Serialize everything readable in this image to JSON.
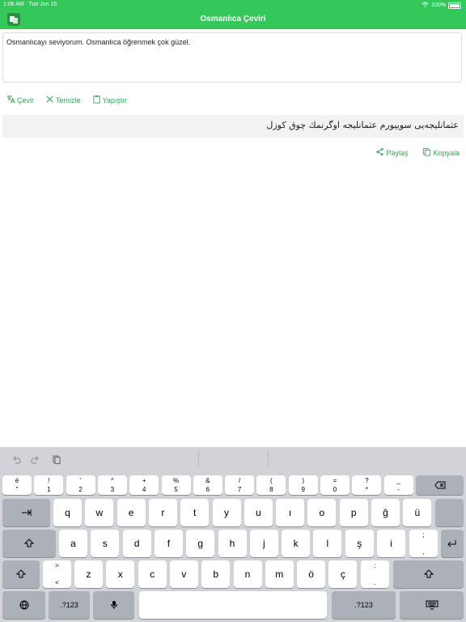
{
  "status": {
    "time": "1:06 AM",
    "date": "Tue Jun 16",
    "battery": "100%"
  },
  "nav": {
    "title": "Osmanlıca Çeviri"
  },
  "input": {
    "text": "Osmanlıcayı seviyorum. Osmanlıca öğrenmek çok güzel."
  },
  "actions": {
    "translate": "Çevir",
    "clear": "Temizle",
    "paste": "Yapıştır"
  },
  "output": {
    "text": "عثمانليجه‌يى سوييورم عثمانليجه اوگرنمك چوق كوزل"
  },
  "output_actions": {
    "share": "Paylaş",
    "copy": "Kopyala"
  },
  "keyboard": {
    "num_row": [
      {
        "top": "é",
        "bot": "\""
      },
      {
        "top": "!",
        "bot": "1"
      },
      {
        "top": "'",
        "bot": "2"
      },
      {
        "top": "^",
        "bot": "3"
      },
      {
        "top": "+",
        "bot": "4"
      },
      {
        "top": "%",
        "bot": "5"
      },
      {
        "top": "&",
        "bot": "6"
      },
      {
        "top": "/",
        "bot": "7"
      },
      {
        "top": "(",
        "bot": "8"
      },
      {
        "top": ")",
        "bot": "9"
      },
      {
        "top": "=",
        "bot": "0"
      },
      {
        "top": "?",
        "bot": "*"
      },
      {
        "top": "_",
        "bot": "-"
      }
    ],
    "row1": [
      "q",
      "w",
      "e",
      "r",
      "t",
      "y",
      "u",
      "ı",
      "o",
      "p",
      "ğ",
      "ü"
    ],
    "row2": [
      "a",
      "s",
      "d",
      "f",
      "g",
      "h",
      "j",
      "k",
      "l",
      "ş",
      "i"
    ],
    "row2_extra": {
      "top": ";",
      "bot": ","
    },
    "row3_left": {
      "top": ">",
      "bot": "<"
    },
    "row3": [
      "z",
      "x",
      "c",
      "v",
      "b",
      "n",
      "m",
      "ö",
      "ç"
    ],
    "row3_extra": {
      "top": ":",
      "bot": "."
    },
    "mode_label": ".?123"
  }
}
